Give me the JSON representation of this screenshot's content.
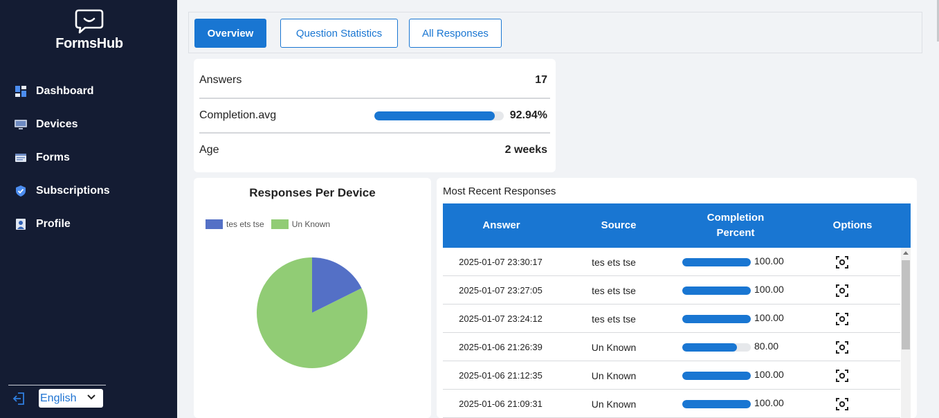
{
  "brand": {
    "name": "FormsHub",
    "icon": "chat-bubble-smile-icon"
  },
  "sidebar": {
    "items": [
      {
        "label": "Dashboard",
        "icon": "dashboard-icon"
      },
      {
        "label": "Devices",
        "icon": "monitor-icon"
      },
      {
        "label": "Forms",
        "icon": "form-icon"
      },
      {
        "label": "Subscriptions",
        "icon": "shield-icon"
      },
      {
        "label": "Profile",
        "icon": "profile-icon"
      }
    ],
    "logout_icon": "logout-icon",
    "language": {
      "selected": "English"
    }
  },
  "tabs": [
    {
      "label": "Overview",
      "active": true
    },
    {
      "label": "Question Statistics",
      "active": false
    },
    {
      "label": "All Responses",
      "active": false
    }
  ],
  "summary": {
    "answers_label": "Answers",
    "answers_value": "17",
    "completion_label": "Completion.avg",
    "completion_value": "92.94%",
    "completion_fraction": 0.9294,
    "age_label": "Age",
    "age_value": "2 weeks"
  },
  "chart_data": {
    "type": "pie",
    "title": "Responses Per Device",
    "legend_placement": "top-left",
    "labels": [
      "tes ets tse",
      "Un Known"
    ],
    "values": [
      3,
      14
    ],
    "colors": [
      "#5470c6",
      "#91cc75"
    ]
  },
  "recent": {
    "title": "Most Recent Responses",
    "columns": [
      "Answer",
      "Source",
      "Completion Percent",
      "Options"
    ],
    "option_icon": "focus-view-icon",
    "rows": [
      {
        "answer": "2025-01-07 23:30:17",
        "source": "tes ets tse",
        "completion": "100.00",
        "value": 100
      },
      {
        "answer": "2025-01-07 23:27:05",
        "source": "tes ets tse",
        "completion": "100.00",
        "value": 100
      },
      {
        "answer": "2025-01-07 23:24:12",
        "source": "tes ets tse",
        "completion": "100.00",
        "value": 100
      },
      {
        "answer": "2025-01-06 21:26:39",
        "source": "Un Known",
        "completion": "80.00",
        "value": 80
      },
      {
        "answer": "2025-01-06 21:12:35",
        "source": "Un Known",
        "completion": "100.00",
        "value": 100
      },
      {
        "answer": "2025-01-06 21:09:31",
        "source": "Un Known",
        "completion": "100.00",
        "value": 100
      }
    ]
  }
}
